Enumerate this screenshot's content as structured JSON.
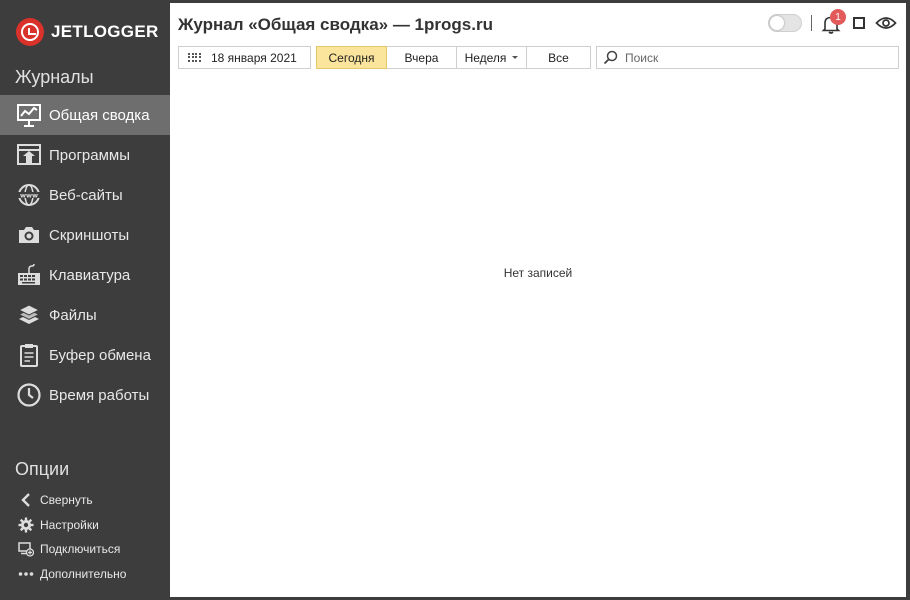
{
  "app": {
    "brand": "JETLOGGER",
    "brand_color": "#d9322b"
  },
  "sidebar": {
    "journals_title": "Журналы",
    "items": [
      {
        "label": "Общая сводка",
        "icon": "summary-chart-icon",
        "active": true
      },
      {
        "label": "Программы",
        "icon": "programs-icon"
      },
      {
        "label": "Веб-сайты",
        "icon": "globe-www-icon"
      },
      {
        "label": "Скриншоты",
        "icon": "camera-icon"
      },
      {
        "label": "Клавиатура",
        "icon": "keyboard-icon"
      },
      {
        "label": "Файлы",
        "icon": "files-icon"
      },
      {
        "label": "Буфер обмена",
        "icon": "clipboard-icon"
      },
      {
        "label": "Время работы",
        "icon": "clock-icon"
      }
    ],
    "options_title": "Опции",
    "options": [
      {
        "label": "Свернуть",
        "icon": "chevron-left-icon"
      },
      {
        "label": "Настройки",
        "icon": "gear-icon"
      },
      {
        "label": "Подключиться",
        "icon": "connect-icon"
      },
      {
        "label": "Дополнительно",
        "icon": "more-dots-icon"
      }
    ]
  },
  "main": {
    "title": "Журнал «Общая сводка» — 1progs.ru",
    "notifications_count": "1",
    "date_label": "18 января 2021",
    "periods": [
      {
        "label": "Сегодня",
        "selected": true
      },
      {
        "label": "Вчера"
      },
      {
        "label": "Неделя",
        "dropdown": true
      },
      {
        "label": "Все"
      }
    ],
    "search": {
      "placeholder": "Поиск",
      "value": ""
    },
    "empty_text": "Нет записей",
    "accent_color": "#fbe49b"
  }
}
